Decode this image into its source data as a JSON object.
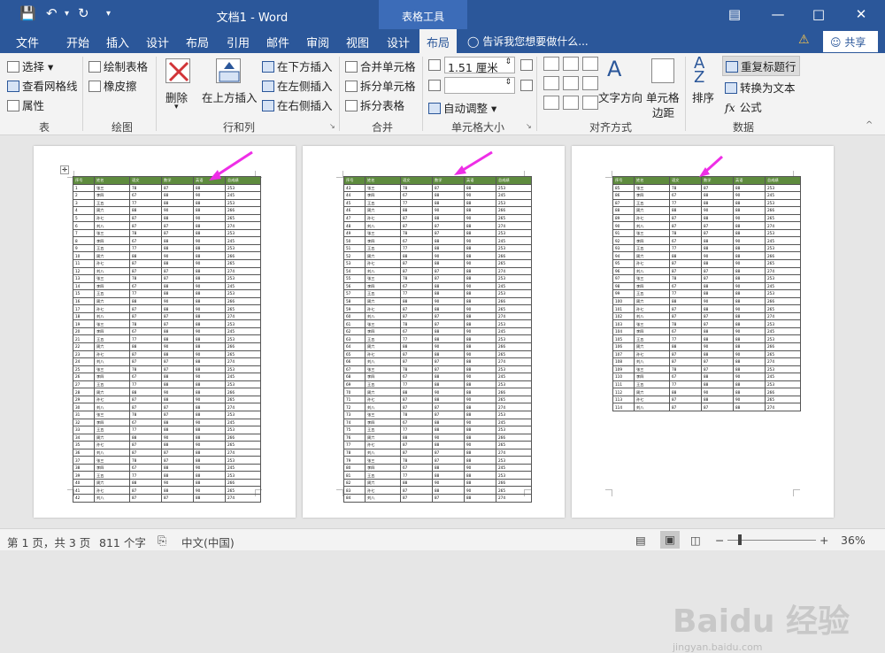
{
  "titlebar": {
    "title": "文档1 - Word",
    "context_tab": "表格工具"
  },
  "tabs": [
    {
      "label": "文件"
    },
    {
      "label": "开始"
    },
    {
      "label": "插入"
    },
    {
      "label": "设计"
    },
    {
      "label": "布局"
    },
    {
      "label": "引用"
    },
    {
      "label": "邮件"
    },
    {
      "label": "审阅"
    },
    {
      "label": "视图"
    },
    {
      "label": "设计"
    },
    {
      "label": "布局"
    }
  ],
  "tell_me": "告诉我您想要做什么...",
  "share": "共享",
  "ribbon": {
    "table": {
      "select": "选择",
      "gridlines": "查看网格线",
      "properties": "属性",
      "group": "表"
    },
    "draw": {
      "draw_table": "绘制表格",
      "eraser": "橡皮擦",
      "group": "绘图"
    },
    "rows_cols": {
      "delete": "删除",
      "insert_above": "在上方插入",
      "insert_below": "在下方插入",
      "insert_left": "在左侧插入",
      "insert_right": "在右侧插入",
      "group": "行和列"
    },
    "merge": {
      "merge_cells": "合并单元格",
      "split_cells": "拆分单元格",
      "split_table": "拆分表格",
      "group": "合并"
    },
    "cell_size": {
      "height_value": "1.51 厘米",
      "autofit": "自动调整",
      "group": "单元格大小"
    },
    "alignment": {
      "text_direction": "文字方向",
      "cell_margins_1": "单元格",
      "cell_margins_2": "边距",
      "group": "对齐方式"
    },
    "data": {
      "sort": "排序",
      "repeat_header": "重复标题行",
      "convert": "转换为文本",
      "formula": "公式",
      "group": "数据"
    }
  },
  "table_header": [
    "序号",
    "姓名",
    "语文",
    "数学",
    "英语",
    "总成绩"
  ],
  "names": [
    "张三",
    "李四",
    "王五",
    "周六",
    "孙七",
    "刘八"
  ],
  "pages": [
    {
      "start": 1,
      "count": 42
    },
    {
      "start": 43,
      "count": 42
    },
    {
      "start": 85,
      "count": 30
    }
  ],
  "status": {
    "page": "第 1 页，共 3 页",
    "words": "811 个字",
    "language": "中文(中国)",
    "zoom": "36%"
  },
  "watermark": "Baidu 经验",
  "watermark_url": "jingyan.baidu.com"
}
